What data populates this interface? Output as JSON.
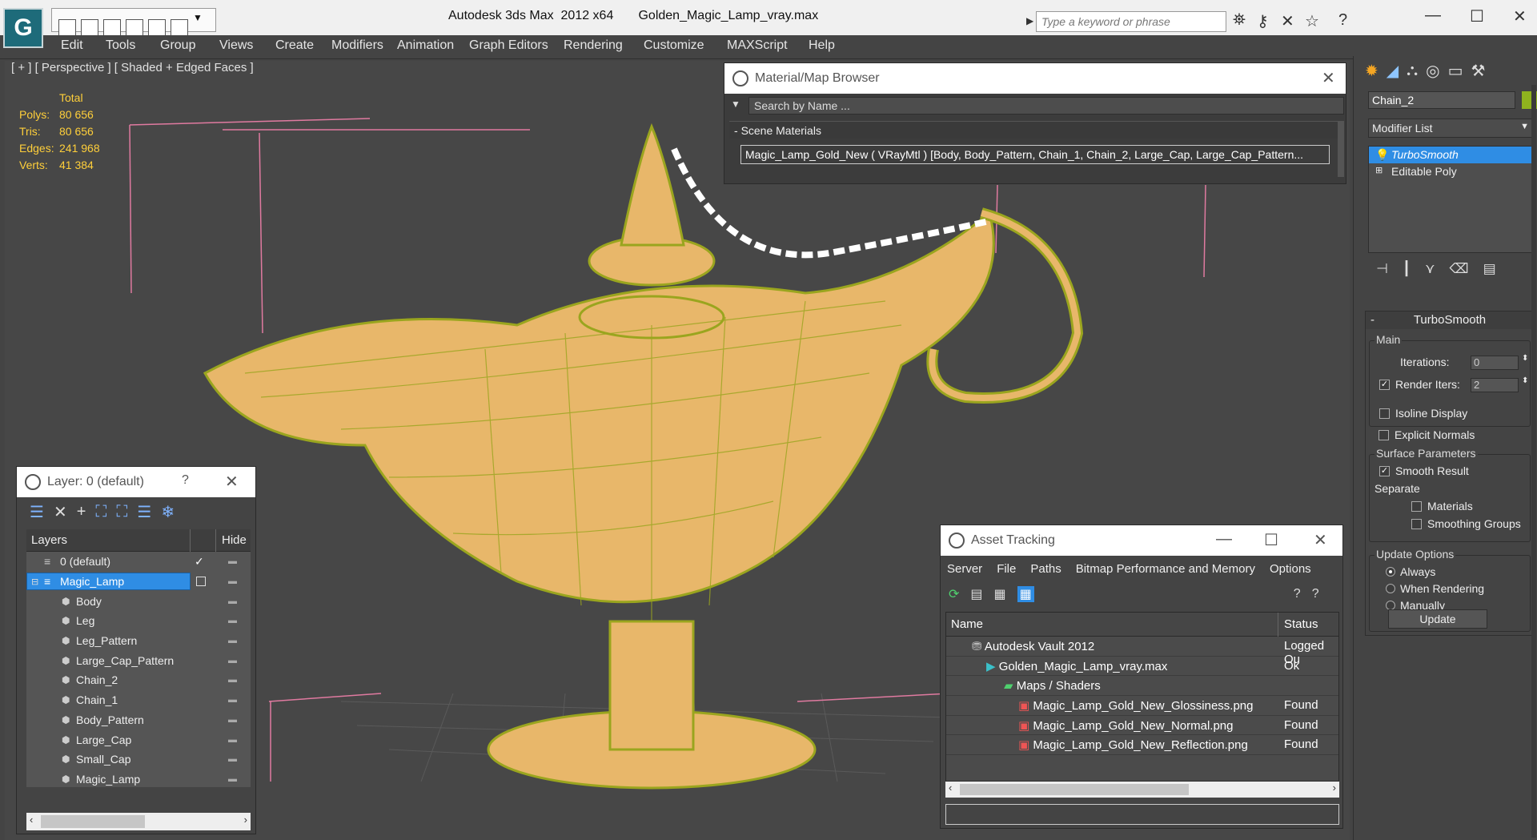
{
  "titlebar": {
    "app_title": "Autodesk 3ds Max  2012 x64",
    "file_name": "Golden_Magic_Lamp_vray.max",
    "search_placeholder": "Type a keyword or phrase"
  },
  "menu": [
    "Edit",
    "Tools",
    "Group",
    "Views",
    "Create",
    "Modifiers",
    "Animation",
    "Graph Editors",
    "Rendering",
    "Customize",
    "MAXScript",
    "Help"
  ],
  "viewport": {
    "label": "[ + ] [ Perspective ] [ Shaded + Edged Faces ]",
    "stats_header": "Total",
    "stats": [
      {
        "k": "Polys:",
        "v": "80 656"
      },
      {
        "k": "Tris:",
        "v": "80 656"
      },
      {
        "k": "Edges:",
        "v": "241 968"
      },
      {
        "k": "Verts:",
        "v": "41 384"
      }
    ],
    "colors": {
      "wire": "#9aa51e",
      "mesh": "#e8b76a",
      "background": "#474747",
      "guide": "#e07aa0"
    }
  },
  "layer_panel": {
    "title": "Layer: 0 (default)",
    "help": "?",
    "col_layers": "Layers",
    "col_hide": "Hide",
    "rows": [
      {
        "name": "0 (default)",
        "indent": 0
      },
      {
        "name": "Magic_Lamp",
        "indent": 0,
        "selected": true
      },
      {
        "name": "Body",
        "indent": 1
      },
      {
        "name": "Leg",
        "indent": 1
      },
      {
        "name": "Leg_Pattern",
        "indent": 1
      },
      {
        "name": "Large_Cap_Pattern",
        "indent": 1
      },
      {
        "name": "Chain_2",
        "indent": 1
      },
      {
        "name": "Chain_1",
        "indent": 1
      },
      {
        "name": "Body_Pattern",
        "indent": 1
      },
      {
        "name": "Large_Cap",
        "indent": 1
      },
      {
        "name": "Small_Cap",
        "indent": 1
      },
      {
        "name": "Magic_Lamp",
        "indent": 1
      }
    ]
  },
  "material_browser": {
    "title": "Material/Map Browser",
    "search_placeholder": "Search by Name ...",
    "section": "Scene Materials",
    "entry": "Magic_Lamp_Gold_New  ( VRayMtl )  [Body, Body_Pattern, Chain_1, Chain_2, Large_Cap, Large_Cap_Pattern..."
  },
  "asset_tracking": {
    "title": "Asset Tracking",
    "menu": [
      "Server",
      "File",
      "Paths",
      "Bitmap Performance and Memory",
      "Options"
    ],
    "col_name": "Name",
    "col_status": "Status",
    "rows": [
      {
        "name": "Autodesk Vault 2012",
        "status": "Logged Ou",
        "indent": 0
      },
      {
        "name": "Golden_Magic_Lamp_vray.max",
        "status": "Ok",
        "indent": 1
      },
      {
        "name": "Maps / Shaders",
        "status": "",
        "indent": 2
      },
      {
        "name": "Magic_Lamp_Gold_New_Glossiness.png",
        "status": "Found",
        "indent": 3
      },
      {
        "name": "Magic_Lamp_Gold_New_Normal.png",
        "status": "Found",
        "indent": 3
      },
      {
        "name": "Magic_Lamp_Gold_New_Reflection.png",
        "status": "Found",
        "indent": 3
      }
    ]
  },
  "command_panel": {
    "object_name": "Chain_2",
    "modifier_list": "Modifier List",
    "stack": [
      {
        "name": "TurboSmooth",
        "selected": true
      },
      {
        "name": "Editable Poly",
        "selected": false
      }
    ],
    "turbosmooth": {
      "title": "TurboSmooth",
      "main_label": "Main",
      "iterations_label": "Iterations:",
      "iterations": "0",
      "render_iters_label": "Render Iters:",
      "render_iters": "2",
      "isoline": "Isoline Display",
      "explicit_normals": "Explicit Normals",
      "surface_label": "Surface Parameters",
      "smooth_result": "Smooth Result",
      "separate_label": "Separate",
      "materials": "Materials",
      "smoothing_groups": "Smoothing Groups",
      "update_label": "Update Options",
      "always": "Always",
      "when_rendering": "When Rendering",
      "manually": "Manually",
      "update_button": "Update"
    }
  }
}
